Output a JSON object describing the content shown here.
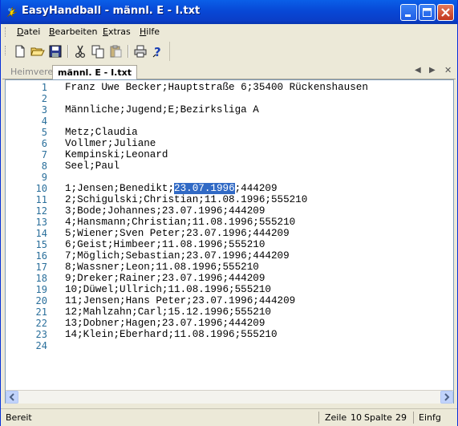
{
  "window": {
    "title": "EasyHandball - männl. E - I.txt"
  },
  "menu": [
    {
      "label": "Datei",
      "accel": "D",
      "rest": "atei"
    },
    {
      "label": "Bearbeiten",
      "accel": "B",
      "rest": "earbeiten"
    },
    {
      "label": "Extras",
      "accel": "E",
      "rest": "xtras"
    },
    {
      "label": "Hilfe",
      "accel": "H",
      "rest": "ilfe"
    }
  ],
  "toolbar": [
    "new-file-icon",
    "open-folder-icon",
    "save-icon",
    "cut-icon",
    "copy-icon",
    "paste-icon",
    "print-icon",
    "help-icon"
  ],
  "tabs": {
    "inactive": "Heimverein",
    "active": "männl. E - I.txt"
  },
  "editor": {
    "line_numbers": [
      "1",
      "2",
      "3",
      "4",
      "5",
      "6",
      "7",
      "8",
      "9",
      "10",
      "11",
      "12",
      "13",
      "14",
      "15",
      "16",
      "17",
      "18",
      "19",
      "20",
      "21",
      "22",
      "23",
      "24"
    ],
    "lines": [
      "Franz Uwe Becker;Hauptstraße 6;35400 Rückenshausen",
      "",
      "Männliche;Jugend;E;Bezirksliga A",
      "",
      "Metz;Claudia",
      "Vollmer;Juliane",
      "Kempinski;Leonard",
      "Seel;Paul",
      "",
      "1;Jensen;Benedikt;23.07.1996;444209",
      "2;Schigulski;Christian;11.08.1996;555210",
      "3;Bode;Johannes;23.07.1996;444209",
      "4;Hansmann;Christian;11.08.1996;555210",
      "5;Wiener;Sven Peter;23.07.1996;444209",
      "6;Geist;Himbeer;11.08.1996;555210",
      "7;Möglich;Sebastian;23.07.1996;444209",
      "8;Wassner;Leon;11.08.1996;555210",
      "9;Dreker;Rainer;23.07.1996;444209",
      "10;Düwel;Ullrich;11.08.1996;555210",
      "11;Jensen;Hans Peter;23.07.1996;444209",
      "12;Mahlzahn;Carl;15.12.1996;555210",
      "13;Dobner;Hagen;23.07.1996;444209",
      "14;Klein;Eberhard;11.08.1996;555210",
      ""
    ],
    "selection": {
      "line_before": "1;Jensen;Benedikt;",
      "selected": "23.07.1996",
      "line_after": ";444209"
    }
  },
  "status": {
    "left": "Bereit",
    "zeile_label": "Zeile",
    "zeile_value": "10",
    "spalte_label": "Spalte",
    "spalte_value": "29",
    "mode": "Einfg"
  }
}
